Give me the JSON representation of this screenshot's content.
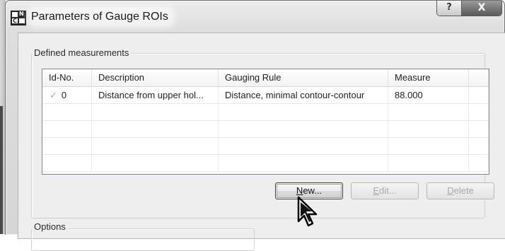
{
  "window": {
    "title": "Parameters of Gauge ROIs",
    "icon": "nc-app-icon",
    "icon_letters": {
      "top": "N",
      "bottom": "C"
    },
    "help_button": "?",
    "close_button": "X"
  },
  "defined_group": {
    "label": "Defined measurements"
  },
  "options_group": {
    "label": "Options"
  },
  "table": {
    "columns": [
      "Id-No.",
      "Description",
      "Gauging Rule",
      "Measure",
      ""
    ],
    "rows": [
      {
        "check": "✓",
        "id": "0",
        "description": "Distance from upper hol...",
        "rule": "Distance, minimal contour-contour",
        "measure": "88.000"
      }
    ],
    "empty_rows": 4
  },
  "buttons": {
    "new": {
      "mnemonic": "N",
      "rest": "ew..."
    },
    "edit": {
      "mnemonic": "E",
      "rest": "dit..."
    },
    "delete": {
      "mnemonic": "D",
      "rest": "elete"
    }
  }
}
